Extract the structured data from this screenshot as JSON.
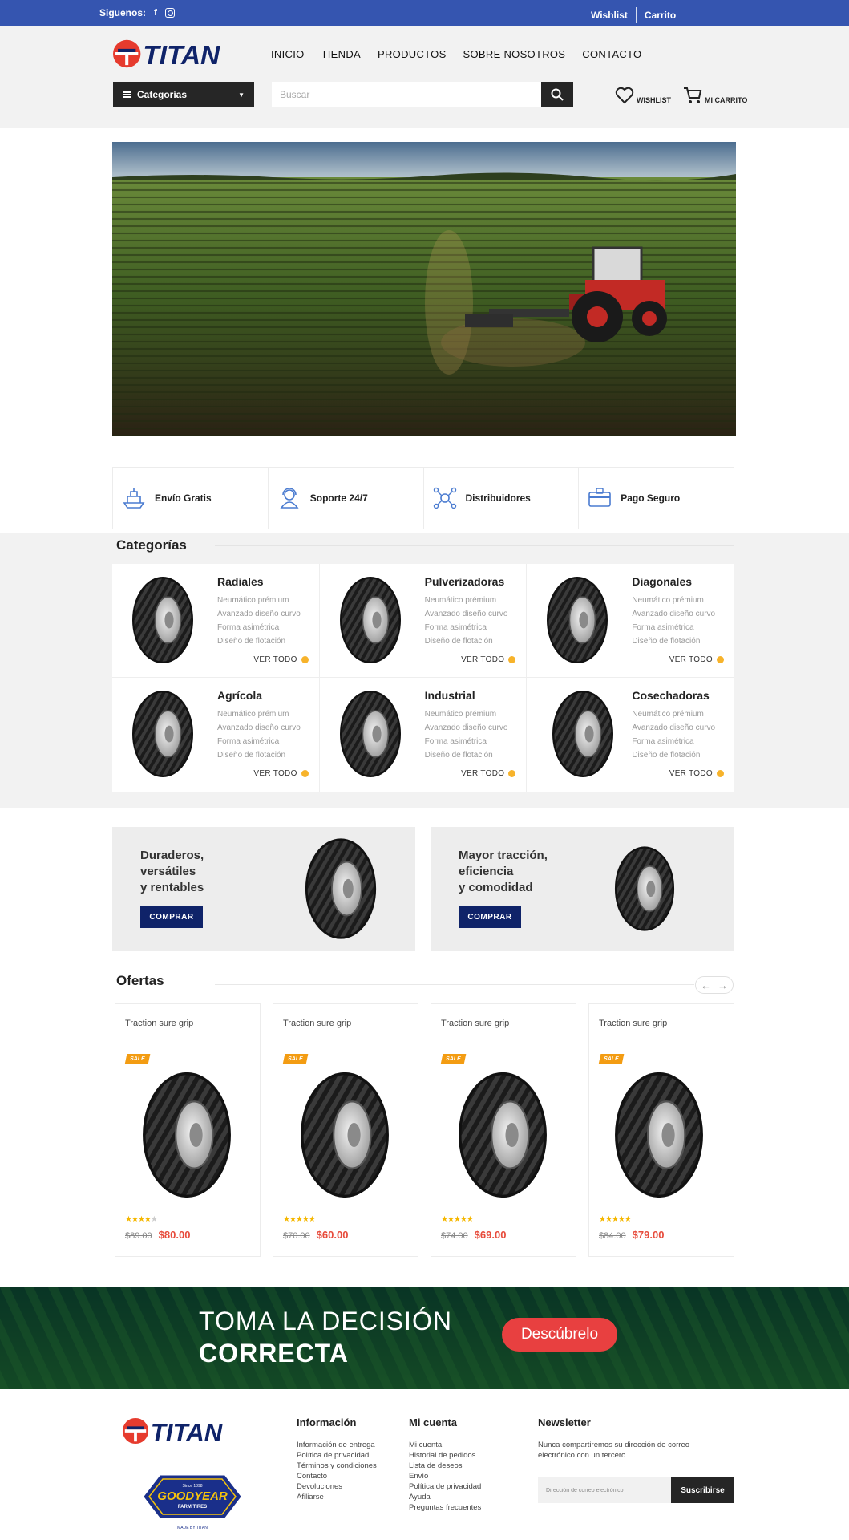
{
  "topbar": {
    "follow_label": "Siguenos:",
    "wishlist": "Wishlist",
    "cart": "Carrito"
  },
  "header": {
    "brand": "TITAN",
    "nav": [
      "INICIO",
      "TIENDA",
      "PRODUCTOS",
      "SOBRE NOSOTROS",
      "CONTACTO"
    ],
    "categories_button": "Categorías",
    "search_placeholder": "Buscar",
    "wishlist_label": "WISHLIST",
    "cart_label": "MI CARRITO"
  },
  "features": [
    "Envío Gratis",
    "Soporte 24/7",
    "Distribuidores",
    "Pago Seguro"
  ],
  "categories": {
    "title": "Categorías",
    "see_all": "VER TODO",
    "items": [
      {
        "name": "Radiales",
        "features": [
          "Neumático prémium",
          "Avanzado diseño curvo",
          "Forma asimétrica",
          "Diseño de flotación"
        ]
      },
      {
        "name": "Pulverizadoras",
        "features": [
          "Neumático prémium",
          "Avanzado diseño curvo",
          "Forma asimétrica",
          "Diseño de flotación"
        ]
      },
      {
        "name": "Diagonales",
        "features": [
          "Neumático prémium",
          "Avanzado diseño curvo",
          "Forma asimétrica",
          "Diseño de flotación"
        ]
      },
      {
        "name": "Agrícola",
        "features": [
          "Neumático prémium",
          "Avanzado diseño curvo",
          "Forma asimétrica",
          "Diseño de flotación"
        ]
      },
      {
        "name": "Industrial",
        "features": [
          "Neumático prémium",
          "Avanzado diseño curvo",
          "Forma asimétrica",
          "Diseño de flotación"
        ]
      },
      {
        "name": "Cosechadoras",
        "features": [
          "Neumático prémium",
          "Avanzado diseño curvo",
          "Forma asimétrica",
          "Diseño de flotación"
        ]
      }
    ]
  },
  "promos": [
    {
      "lines": [
        "Duraderos,",
        "versátiles",
        "y rentables"
      ],
      "button": "COMPRAR"
    },
    {
      "lines": [
        "Mayor tracción,",
        "eficiencia",
        "y comodidad"
      ],
      "button": "COMPRAR"
    }
  ],
  "offers": {
    "title": "Ofertas",
    "items": [
      {
        "title": "Traction sure grip",
        "badge": "SALE",
        "rating": 4,
        "old_price": "$89.00",
        "price": "$80.00"
      },
      {
        "title": "Traction sure grip",
        "badge": "SALE",
        "rating": 5,
        "old_price": "$70.00",
        "price": "$60.00"
      },
      {
        "title": "Traction sure grip",
        "badge": "SALE",
        "rating": 5,
        "old_price": "$74.00",
        "price": "$69.00"
      },
      {
        "title": "Traction sure grip",
        "badge": "SALE",
        "rating": 5,
        "old_price": "$84.00",
        "price": "$79.00"
      }
    ]
  },
  "banner": {
    "line1": "TOMA LA DECISIÓN",
    "line2": "CORRECTA",
    "button": "Descúbrelo"
  },
  "footer": {
    "brand": "TITAN",
    "goodyear": {
      "top": "Since 1898",
      "name": "GOODYEAR",
      "sub": "FARM TIRES",
      "made": "MADE BY TITAN"
    },
    "info": {
      "title": "Información",
      "links": [
        "Información de entrega",
        "Política de privacidad",
        "Términos y condiciones",
        "Contacto",
        "Devoluciones",
        "Afiliarse"
      ]
    },
    "account": {
      "title": "Mi cuenta",
      "links": [
        "Mi cuenta",
        "Historial de pedidos",
        "Lista de deseos",
        "Envío",
        "Política de privacidad",
        "Ayuda",
        "Preguntas frecuentes"
      ]
    },
    "newsletter": {
      "title": "Newsletter",
      "text": "Nunca compartiremos su dirección de correo electrónico con un tercero",
      "placeholder": "Dirección de correo electrónico",
      "button": "Suscribirse"
    }
  },
  "colors": {
    "topbar": "#3555b0",
    "brand_red": "#e63b2e",
    "brand_blue": "#0f2369",
    "sale": "#f39c12",
    "price": "#e74c3c",
    "star": "#f5b700",
    "dot": "#f7b32b"
  }
}
